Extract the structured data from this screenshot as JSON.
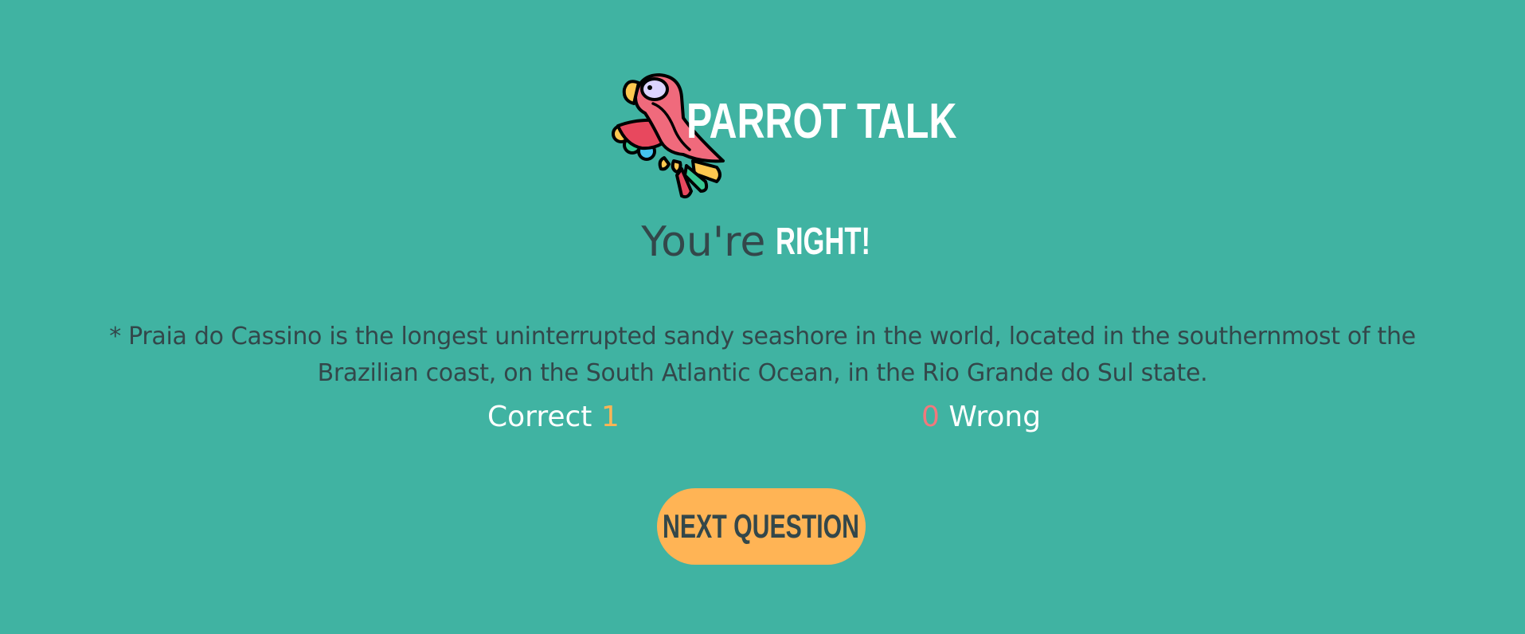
{
  "header": {
    "title": "PARROT TALK",
    "logo_icon": "parrot-icon"
  },
  "result": {
    "prefix": "You're",
    "verdict": "RIGHT!"
  },
  "fact": {
    "text": "* Praia do Cassino is the longest uninterrupted sandy seashore in the world, located in the southernmost of the Brazilian coast, on the South Atlantic Ocean, in the Rio Grande do Sul state."
  },
  "score": {
    "correct_label": "Correct",
    "correct_count": "1",
    "wrong_count": "0",
    "wrong_label": "Wrong"
  },
  "actions": {
    "next_label": "NEXT QUESTION"
  },
  "colors": {
    "background": "#40b3a2",
    "accent": "#ffb455",
    "wrong": "#f2787c",
    "text_dark": "#33474a",
    "text_light": "#ffffff"
  }
}
